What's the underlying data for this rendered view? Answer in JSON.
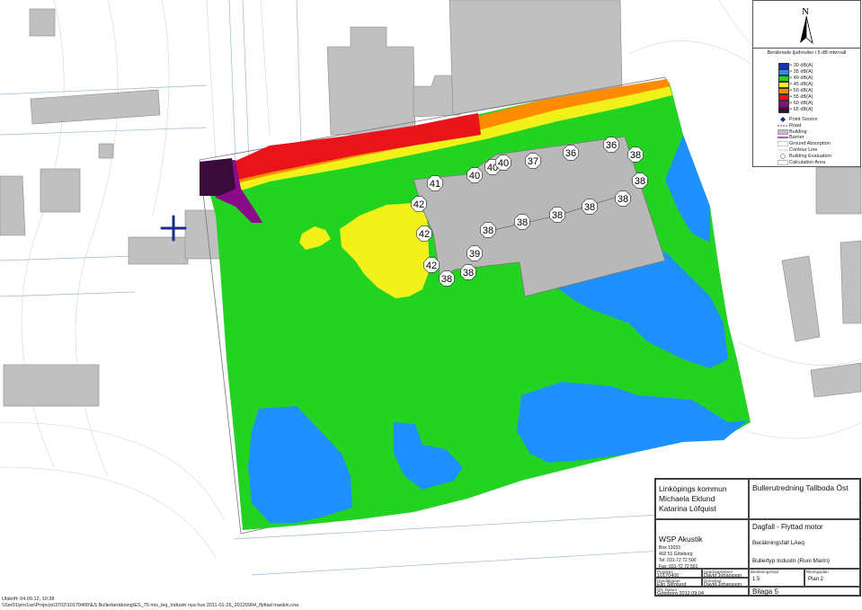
{
  "legend": {
    "title": "Beräknade ljudnivåer i 5 dB intervall",
    "levels": [
      {
        "label": "> 30 dB(A)",
        "color": "#1a2fc8"
      },
      {
        "label": "> 35 dB(A)",
        "color": "#1e90ff"
      },
      {
        "label": "> 40 dB(A)",
        "color": "#22d322"
      },
      {
        "label": "> 45 dB(A)",
        "color": "#f2f21a"
      },
      {
        "label": "> 50 dB(A)",
        "color": "#ff8c00"
      },
      {
        "label": "> 55 dB(A)",
        "color": "#e8141a"
      },
      {
        "label": "> 60 dB(A)",
        "color": "#8a0a8a"
      },
      {
        "label": "> 65 dB(A)",
        "color": "#3a0a3a"
      }
    ],
    "symbols": [
      {
        "label": "Point Source",
        "icon": "point-source-icon"
      },
      {
        "label": "Road",
        "icon": "road-icon"
      },
      {
        "label": "Building",
        "icon": "building-icon"
      },
      {
        "label": "Barrier",
        "icon": "barrier-icon"
      },
      {
        "label": "Ground Absorption",
        "icon": "ground-absorption-icon"
      },
      {
        "label": "Contour Line",
        "icon": "contour-line-icon"
      },
      {
        "label": "Building Evaluation",
        "icon": "building-evaluation-icon"
      },
      {
        "label": "Calculation Area",
        "icon": "calculation-area-icon"
      }
    ],
    "north": "N"
  },
  "map_labels": [
    "42",
    "41",
    "40",
    "40",
    "40",
    "37",
    "36",
    "36",
    "38",
    "38",
    "38",
    "38",
    "38",
    "38",
    "38",
    "42",
    "38",
    "39",
    "42",
    "38",
    "38"
  ],
  "title_block": {
    "client_1": "Linköpings kommun",
    "client_2": "Michaela Eklund",
    "client_3": "Katarina Löfquist",
    "project_title": "Bullerutredning Tallboda Öst",
    "company": "WSP Akustik",
    "addr_1": "Box 13033",
    "addr_2": "402 51 Göteborg",
    "tel": "Tel: 031-72 72 500",
    "fax": "Fax: 031-72 72 501",
    "drawing_title": "Dagfall - Flyttad motor",
    "case": "Beräkningsfall LAeq",
    "type": "Bullertyp Industri (Runi Marin)",
    "lbl_project_no": "Projektnr",
    "project_no": "10170400",
    "lbl_made_by": "Uppdragsledare",
    "made_by": "David Johansson",
    "lbl_scale": "Beräkningshöjd",
    "scale": "1.5",
    "lbl_plan": "Ritningsplan",
    "plan": "Plan 2",
    "lbl_handled": "Handläggare",
    "handled": "Elin Stenlund",
    "lbl_checked": "Granskad",
    "checked": "David Johansson",
    "lbl_date": "Ort, Datum",
    "date": "Göteborg 2012.09.04",
    "appendix": "Bilaga 5"
  },
  "footer": {
    "printed": "Utskrift: 04.09.12, 10:38",
    "path": "\\\\Ser01\\pro1se\\Projects\\3702\\10170400\\ES Bullerberäkning\\ES_75 mix_leq_Industri nya hus 2011-01-26_20120904_flyttad maskin.cna"
  }
}
